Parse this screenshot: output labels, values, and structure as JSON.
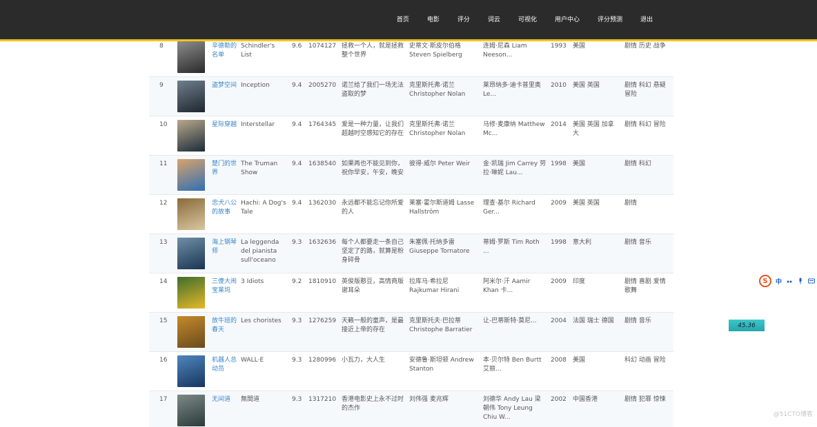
{
  "nav": {
    "items": [
      "首页",
      "电影",
      "评分",
      "词云",
      "可视化",
      "用户中心",
      "评分预测",
      "退出"
    ]
  },
  "table": {
    "rows": [
      {
        "rank": "8",
        "cn": "辛德勒的名单",
        "en": "Schindler's List",
        "score": "9.6",
        "votes": "1074127",
        "quote": "拯救一个人，就是拯救整个世界",
        "director": "史蒂文·斯皮尔伯格 Steven Spielberg",
        "actors": "连姆·尼森 Liam Neeson...",
        "year": "1993",
        "country": "美国",
        "genre": "剧情 历史 战争",
        "poster": [
          "#2a2a2a",
          "#8c8c8c"
        ]
      },
      {
        "rank": "9",
        "cn": "盗梦空间",
        "en": "Inception",
        "score": "9.4",
        "votes": "2005270",
        "quote": "诺兰给了我们一场无法盗取的梦",
        "director": "克里斯托弗·诺兰 Christopher Nolan",
        "actors": "莱昂纳多·迪卡普里奥 Le...",
        "year": "2010",
        "country": "美国 英国",
        "genre": "剧情 科幻 悬疑 冒险",
        "poster": [
          "#1e2630",
          "#6f7f8c"
        ]
      },
      {
        "rank": "10",
        "cn": "星际穿越",
        "en": "Interstellar",
        "score": "9.4",
        "votes": "1764345",
        "quote": "爱是一种力量，让我们超越时空感知它的存在",
        "director": "克里斯托弗·诺兰 Christopher Nolan",
        "actors": "马修·麦康纳 Matthew Mc...",
        "year": "2014",
        "country": "美国 英国 加拿大",
        "genre": "剧情 科幻 冒险",
        "poster": [
          "#1b2c3a",
          "#b9a88a"
        ]
      },
      {
        "rank": "11",
        "cn": "楚门的世界",
        "en": "The Truman Show",
        "score": "9.4",
        "votes": "1638540",
        "quote": "如果再也不能见到你，祝你早安，午安，晚安",
        "director": "彼得·威尔 Peter Weir",
        "actors": "金·凯瑞 Jim Carrey 劳拉·琳妮 Lau...",
        "year": "1998",
        "country": "美国",
        "genre": "剧情 科幻",
        "poster": [
          "#2f6fb5",
          "#d9a36b"
        ]
      },
      {
        "rank": "12",
        "cn": "忠犬八公的故事",
        "en": "Hachi: A Dog's Tale",
        "score": "9.4",
        "votes": "1362030",
        "quote": "永远都不能忘记你所爱的人",
        "director": "莱塞·霍尔斯道姆 Lasse Hallström",
        "actors": "理查·基尔 Richard Ger...",
        "year": "2009",
        "country": "美国 英国",
        "genre": "剧情",
        "poster": [
          "#d9c7a0",
          "#8a6a3a"
        ]
      },
      {
        "rank": "13",
        "cn": "海上钢琴师",
        "en": "La leggenda del pianista sull'oceano",
        "score": "9.3",
        "votes": "1632636",
        "quote": "每个人都要走一条自己坚定了的路，就算是粉身碎骨",
        "director": "朱塞佩·托纳多雷 Giuseppe Tornatore",
        "actors": "蒂姆·罗斯 Tim Roth ...",
        "year": "1998",
        "country": "意大利",
        "genre": "剧情 音乐",
        "poster": [
          "#1a3550",
          "#6f8fa8"
        ]
      },
      {
        "rank": "14",
        "cn": "三傻大闹宝莱坞",
        "en": "3 Idiots",
        "score": "9.2",
        "votes": "1810910",
        "quote": "英俊版憨豆，高情商版谢耳朵",
        "director": "拉库马·希拉尼 Rajkumar Hirani",
        "actors": "阿米尔·汗 Aamir Khan 卡...",
        "year": "2009",
        "country": "印度",
        "genre": "剧情 喜剧 爱情 歌舞",
        "poster": [
          "#e7b82a",
          "#3f6d2c"
        ]
      },
      {
        "rank": "15",
        "cn": "放牛班的春天",
        "en": "Les choristes",
        "score": "9.3",
        "votes": "1276259",
        "quote": "天籁一般的童声，是最接近上帝的存在",
        "director": "克里斯托夫·巴拉蒂 Christophe Barratier",
        "actors": "让-巴蒂斯特·莫尼...",
        "year": "2004",
        "country": "法国 瑞士 德国",
        "genre": "剧情 音乐",
        "poster": [
          "#6a4a1e",
          "#c48a2a"
        ]
      },
      {
        "rank": "16",
        "cn": "机器人总动员",
        "en": "WALL·E",
        "score": "9.3",
        "votes": "1280996",
        "quote": "小瓦力，大人生",
        "director": "安德鲁·斯坦顿 Andrew Stanton",
        "actors": "本·贝尔特 Ben Burtt 艾丽...",
        "year": "2008",
        "country": "美国",
        "genre": "科幻 动画 冒险",
        "poster": [
          "#17355c",
          "#4f86bf"
        ]
      },
      {
        "rank": "17",
        "cn": "无间道",
        "en": "無間道",
        "score": "9.3",
        "votes": "1317210",
        "quote": "香港电影史上永不过时的杰作",
        "director": "刘伟强 麦兆辉",
        "actors": "刘德华 Andy Lau 梁朝伟 Tony Leung Chiu W...",
        "year": "2002",
        "country": "中国香港",
        "genre": "剧情 犯罪 惊悚",
        "poster": [
          "#2a3a3a",
          "#7c8a86"
        ]
      }
    ]
  },
  "overlay": {
    "ime_logo": "S",
    "ime_label": "中",
    "speed": "45.36",
    "watermark": "@51CTO博客"
  },
  "colors": {
    "topbar": "#2b2b2b",
    "accent": "#f0c419",
    "link": "#3a86c8"
  }
}
